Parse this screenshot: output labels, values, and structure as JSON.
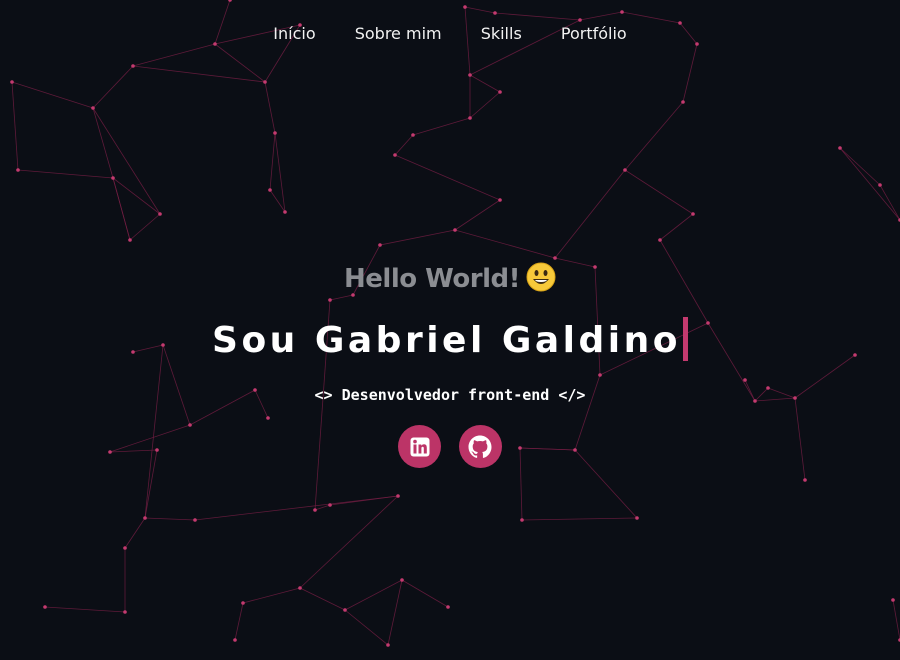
{
  "nav": {
    "items": [
      {
        "label": "Início"
      },
      {
        "label": "Sobre mim"
      },
      {
        "label": "Skills"
      },
      {
        "label": "Portfólio"
      }
    ]
  },
  "hero": {
    "greeting": "Hello World!",
    "greeting_emoji": "grinning-face-icon",
    "name": "Sou Gabriel Galdino",
    "role": "<> Desenvolvedor front-end </>"
  },
  "socials": [
    {
      "icon": "linkedin-icon",
      "label": "LinkedIn"
    },
    {
      "icon": "github-icon",
      "label": "GitHub"
    }
  ],
  "colors": {
    "background": "#0b0e15",
    "accent": "#bc3467",
    "network_line": "#7a1f45",
    "network_node": "#c43a6f",
    "greeting_text": "#8b8d92",
    "heading_text": "#ffffff"
  }
}
